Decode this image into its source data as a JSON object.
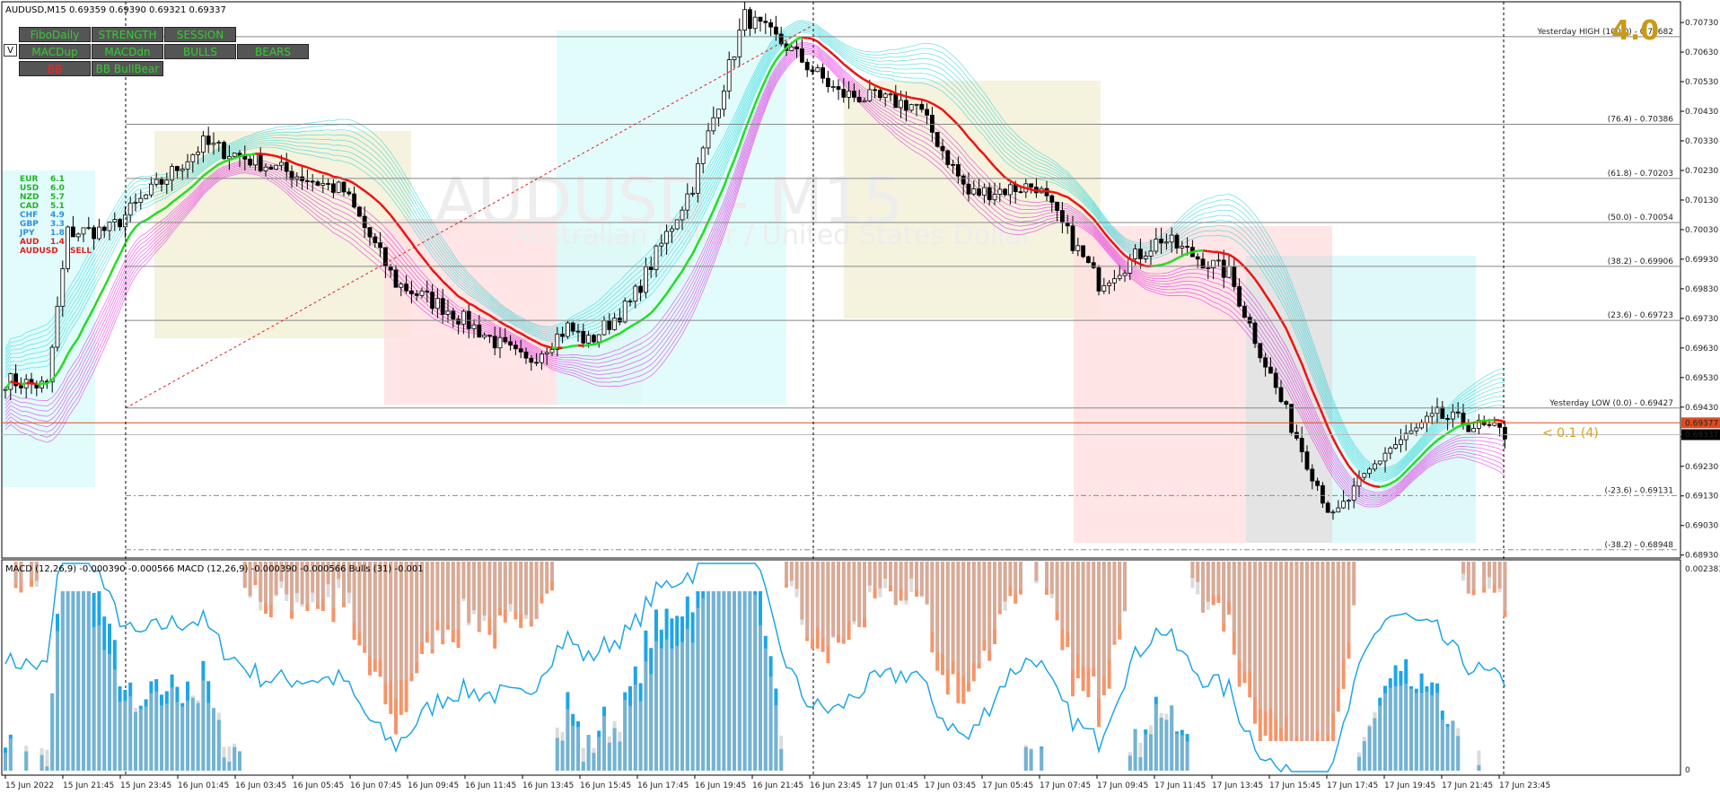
{
  "header": {
    "symbol_text": "AUDUSD,M15  0.69359 0.69390 0.69321 0.69337",
    "watermark_main": "AUDUSD - M15",
    "watermark_sub": "Australian Dollar / United States Dollar",
    "version_label": "4.0",
    "info_label": "< 0.1 (4)"
  },
  "toolbar": {
    "v_label": "V",
    "buttons": [
      {
        "id": "fibodaily",
        "label": "FiboDaily",
        "color": "#32CD32"
      },
      {
        "id": "strength",
        "label": "STRENGTH",
        "color": "#32CD32"
      },
      {
        "id": "session",
        "label": "SESSION",
        "color": "#32CD32"
      },
      {
        "id": "macdup",
        "label": "MACDup",
        "color": "#32CD32"
      },
      {
        "id": "macddn",
        "label": "MACDdn",
        "color": "#32CD32"
      },
      {
        "id": "bulls",
        "label": "BULLS",
        "color": "#32CD32"
      },
      {
        "id": "bears",
        "label": "BEARS",
        "color": "#32CD32"
      },
      {
        "id": "bb",
        "label": "BB",
        "color": "#FF2020"
      },
      {
        "id": "bbbullbear",
        "label": "BB BullBear",
        "color": "#32CD32"
      }
    ]
  },
  "strength_panel": [
    {
      "cur": "EUR",
      "val": "6.1",
      "color": "#22B422"
    },
    {
      "cur": "USD",
      "val": "6.0",
      "color": "#22B422"
    },
    {
      "cur": "NZD",
      "val": "5.7",
      "color": "#22B422"
    },
    {
      "cur": "CAD",
      "val": "5.1",
      "color": "#22B422"
    },
    {
      "cur": "CHF",
      "val": "4.9",
      "color": "#2E8FE0"
    },
    {
      "cur": "GBP",
      "val": "3.3",
      "color": "#2E8FE0"
    },
    {
      "cur": "JPY",
      "val": "1.8",
      "color": "#2E8FE0"
    },
    {
      "cur": "AUD",
      "val": "1.4",
      "color": "#E02020"
    },
    {
      "cur": "AUDUSD",
      "val": "SELL",
      "color": "#E02020"
    }
  ],
  "price_axis": {
    "ticks": [
      "0.70730",
      "0.70630",
      "0.70530",
      "0.70430",
      "0.70330",
      "0.70230",
      "0.70130",
      "0.70030",
      "0.69930",
      "0.69830",
      "0.69730",
      "0.69630",
      "0.69530",
      "0.69430",
      "0.69330",
      "0.69230",
      "0.69130",
      "0.69030",
      "0.68930"
    ],
    "bid_label": "0.69377",
    "last_label": "0.69337"
  },
  "fibo_labels": [
    {
      "price": 0.70682,
      "text": "Yesterday HIGH (100.0) - 0.70682"
    },
    {
      "price": 0.70386,
      "text": "(76.4) - 0.70386"
    },
    {
      "price": 0.70203,
      "text": "(61.8) - 0.70203"
    },
    {
      "price": 0.70054,
      "text": "(50.0) - 0.70054"
    },
    {
      "price": 0.69906,
      "text": "(38.2) - 0.69906"
    },
    {
      "price": 0.69723,
      "text": "(23.6) - 0.69723"
    },
    {
      "price": 0.69427,
      "text": "Yesterday LOW (0.0) - 0.69427"
    },
    {
      "price": 0.69131,
      "text": "(-23.6) - 0.69131"
    },
    {
      "price": 0.68948,
      "text": "(-38.2) - 0.68948"
    }
  ],
  "macd_panel": {
    "label": "MACD (12,26,9) -0.000390 -0.000566  MACD (12,26,9) -0.000390 -0.000566  Bulls (31) -0.001",
    "top_tick": "0.002383",
    "zero_tick": "0"
  },
  "time_axis": [
    "15 Jun 2022",
    "15 Jun 21:45",
    "15 Jun 23:45",
    "16 Jun 01:45",
    "16 Jun 03:45",
    "16 Jun 05:45",
    "16 Jun 07:45",
    "16 Jun 09:45",
    "16 Jun 11:45",
    "16 Jun 13:45",
    "16 Jun 15:45",
    "16 Jun 17:45",
    "16 Jun 19:45",
    "16 Jun 21:45",
    "16 Jun 23:45",
    "17 Jun 01:45",
    "17 Jun 03:45",
    "17 Jun 05:45",
    "17 Jun 07:45",
    "17 Jun 09:45",
    "17 Jun 11:45",
    "17 Jun 13:45",
    "17 Jun 15:45",
    "17 Jun 17:45",
    "17 Jun 19:45",
    "17 Jun 21:45",
    "17 Jun 23:45"
  ],
  "colors": {
    "up_ma": "#22DD22",
    "down_ma": "#EE1111",
    "band_bull": "#00CED1",
    "band_bear": "#DD00DD",
    "macd_blue": "#1EA5E6",
    "macd_orange": "#F4956A",
    "bulls_gray": "#BDBDBD"
  },
  "chart_data": {
    "type": "candlestick",
    "symbol": "AUDUSD",
    "timeframe": "M15",
    "ylim": [
      0.6892,
      0.708
    ],
    "key_points": [
      {
        "bar": 0,
        "price": 0.6952
      },
      {
        "bar": 8,
        "price": 0.695
      },
      {
        "bar": 12,
        "price": 0.7002
      },
      {
        "bar": 20,
        "price": 0.7003
      },
      {
        "bar": 38,
        "price": 0.7032
      },
      {
        "bar": 55,
        "price": 0.7022
      },
      {
        "bar": 65,
        "price": 0.7016
      },
      {
        "bar": 75,
        "price": 0.6985
      },
      {
        "bar": 85,
        "price": 0.6976
      },
      {
        "bar": 100,
        "price": 0.6958
      },
      {
        "bar": 108,
        "price": 0.697
      },
      {
        "bar": 112,
        "price": 0.6965
      },
      {
        "bar": 120,
        "price": 0.6978
      },
      {
        "bar": 132,
        "price": 0.7018
      },
      {
        "bar": 142,
        "price": 0.7075
      },
      {
        "bar": 150,
        "price": 0.7065
      },
      {
        "bar": 160,
        "price": 0.7049
      },
      {
        "bar": 175,
        "price": 0.7045
      },
      {
        "bar": 185,
        "price": 0.7015
      },
      {
        "bar": 198,
        "price": 0.7018
      },
      {
        "bar": 210,
        "price": 0.6985
      },
      {
        "bar": 222,
        "price": 0.7
      },
      {
        "bar": 235,
        "price": 0.6988
      },
      {
        "bar": 245,
        "price": 0.6945
      },
      {
        "bar": 255,
        "price": 0.6905
      },
      {
        "bar": 265,
        "price": 0.6928
      },
      {
        "bar": 275,
        "price": 0.694
      },
      {
        "bar": 288,
        "price": 0.6934
      }
    ]
  }
}
